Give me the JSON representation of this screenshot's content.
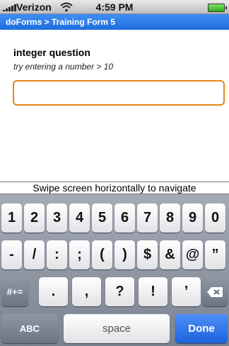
{
  "status_bar": {
    "carrier": "Verizon",
    "time": "4:59 PM"
  },
  "title_bar": {
    "text": "doForms > Training Form 5"
  },
  "form": {
    "question": "integer question",
    "hint": "try entering a number > 10",
    "answer_value": ""
  },
  "swipe_hint": "Swipe screen horizontally to navigate",
  "keyboard": {
    "row1": [
      "1",
      "2",
      "3",
      "4",
      "5",
      "6",
      "7",
      "8",
      "9",
      "0"
    ],
    "row2": [
      "-",
      "/",
      ":",
      ";",
      "(",
      ")",
      "$",
      "&",
      "@",
      "”"
    ],
    "row3": [
      ".",
      ",",
      "?",
      "!",
      "’"
    ],
    "symbols_label": "#+=",
    "abc_label": "ABC",
    "space_label": "space",
    "done_label": "Done"
  }
}
